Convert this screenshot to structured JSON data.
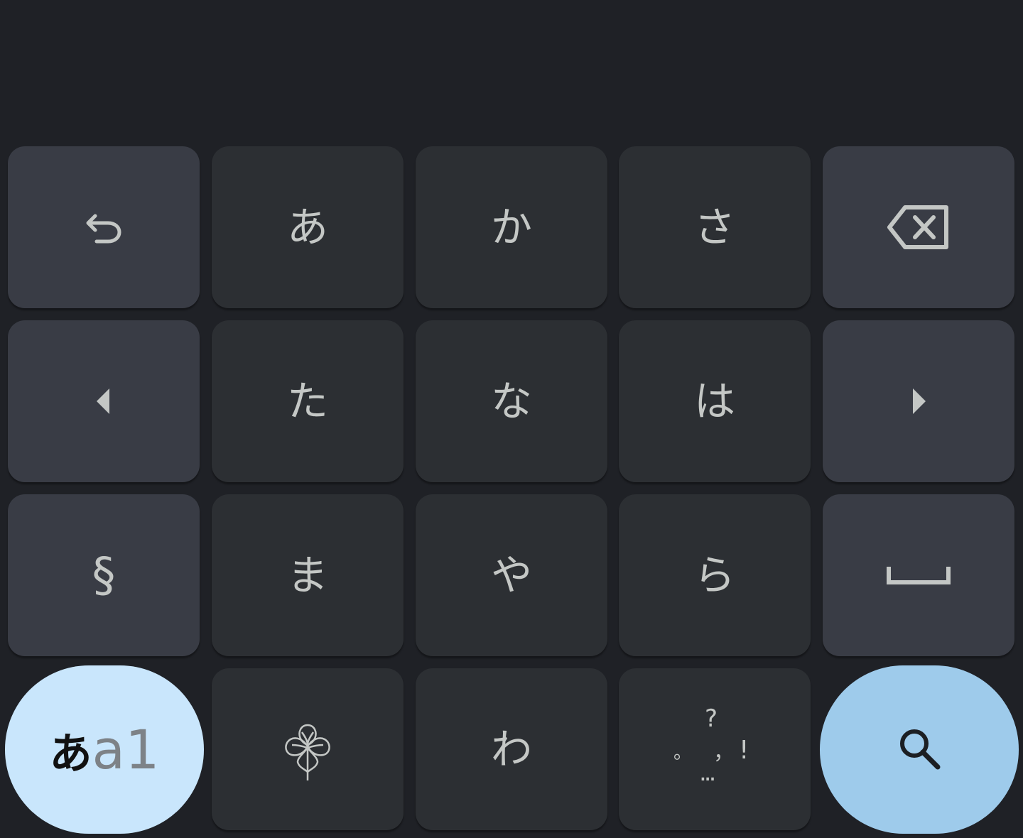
{
  "keyboard": {
    "keys": {
      "undo": {
        "icon": "undo-icon"
      },
      "a": "あ",
      "ka": "か",
      "sa": "さ",
      "backspace": {
        "icon": "backspace-icon"
      },
      "cursor_left": {
        "icon": "caret-left-icon"
      },
      "ta": "た",
      "na": "な",
      "ha": "は",
      "cursor_right": {
        "icon": "caret-right-icon"
      },
      "symbol": "§",
      "ma": "ま",
      "ya": "や",
      "ra": "ら",
      "space": {
        "icon": "space-icon"
      },
      "mode": {
        "kana": "あ",
        "alpha": "a1"
      },
      "emoji": {
        "icon": "clover-icon"
      },
      "wa": "わ",
      "punctuation": {
        "question": "?",
        "period": "。",
        "comma": "，",
        "exclamation": "!",
        "ellipsis": "..."
      },
      "search": {
        "icon": "search-icon"
      }
    }
  },
  "colors": {
    "background": "#1f2126",
    "kana_key": "#2c2f33",
    "function_key": "#393c45",
    "key_text": "#c4c7c5",
    "mode_pill": "#c9e6fc",
    "search_pill": "#9ecbeb"
  }
}
